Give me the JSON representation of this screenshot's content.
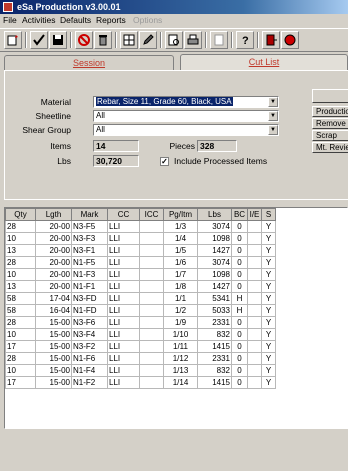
{
  "window": {
    "title": "eSa Production v3.00.01"
  },
  "menu": [
    "File",
    "Activities",
    "Defaults",
    "Reports",
    "Options"
  ],
  "tabs": [
    {
      "label": "Session",
      "active": false
    },
    {
      "label": "Cut List",
      "active": true
    }
  ],
  "filters": {
    "material_label": "Material",
    "material_value": "Rebar, Size 11, Grade 60, Black, USA",
    "sheetline_label": "Sheetline",
    "sheetline_value": "All",
    "shear_group_label": "Shear Group",
    "shear_group_value": "All",
    "items_label": "Items",
    "items_value": "14",
    "pieces_label": "Pieces",
    "pieces_value": "328",
    "lbs_label": "Lbs",
    "lbs_value": "30,720",
    "include_processed_label": "Include Processed Items",
    "include_processed_checked": true
  },
  "side_buttons": [
    "Production",
    "Remove",
    "Scrap",
    "Mt. Review"
  ],
  "table": {
    "columns": [
      "Qty",
      "Lgth",
      "Mark",
      "CC",
      "ICC",
      "Pg/Itm",
      "Lbs",
      "BC",
      "I/E",
      "S"
    ],
    "rows": [
      [
        "28",
        "20-00",
        "N3-F5",
        "LLI",
        "",
        "1/3",
        "3074",
        "0",
        "",
        "Y"
      ],
      [
        "10",
        "20-00",
        "N3-F3",
        "LLI",
        "",
        "1/4",
        "1098",
        "0",
        "",
        "Y"
      ],
      [
        "13",
        "20-00",
        "N3-F1",
        "LLI",
        "",
        "1/5",
        "1427",
        "0",
        "",
        "Y"
      ],
      [
        "28",
        "20-00",
        "N1-F5",
        "LLI",
        "",
        "1/6",
        "3074",
        "0",
        "",
        "Y"
      ],
      [
        "10",
        "20-00",
        "N1-F3",
        "LLI",
        "",
        "1/7",
        "1098",
        "0",
        "",
        "Y"
      ],
      [
        "13",
        "20-00",
        "N1-F1",
        "LLI",
        "",
        "1/8",
        "1427",
        "0",
        "",
        "Y"
      ],
      [
        "58",
        "17-04",
        "N3-FD",
        "LLI",
        "",
        "1/1",
        "5341",
        "H",
        "",
        "Y"
      ],
      [
        "58",
        "16-04",
        "N1-FD",
        "LLI",
        "",
        "1/2",
        "5033",
        "H",
        "",
        "Y"
      ],
      [
        "28",
        "15-00",
        "N3-F6",
        "LLI",
        "",
        "1/9",
        "2331",
        "0",
        "",
        "Y"
      ],
      [
        "10",
        "15-00",
        "N3-F4",
        "LLI",
        "",
        "1/10",
        "832",
        "0",
        "",
        "Y"
      ],
      [
        "17",
        "15-00",
        "N3-F2",
        "LLI",
        "",
        "1/11",
        "1415",
        "0",
        "",
        "Y"
      ],
      [
        "28",
        "15-00",
        "N1-F6",
        "LLI",
        "",
        "1/12",
        "2331",
        "0",
        "",
        "Y"
      ],
      [
        "10",
        "15-00",
        "N1-F4",
        "LLI",
        "",
        "1/13",
        "832",
        "0",
        "",
        "Y"
      ],
      [
        "17",
        "15-00",
        "N1-F2",
        "LLI",
        "",
        "1/14",
        "1415",
        "0",
        "",
        "Y"
      ]
    ]
  }
}
